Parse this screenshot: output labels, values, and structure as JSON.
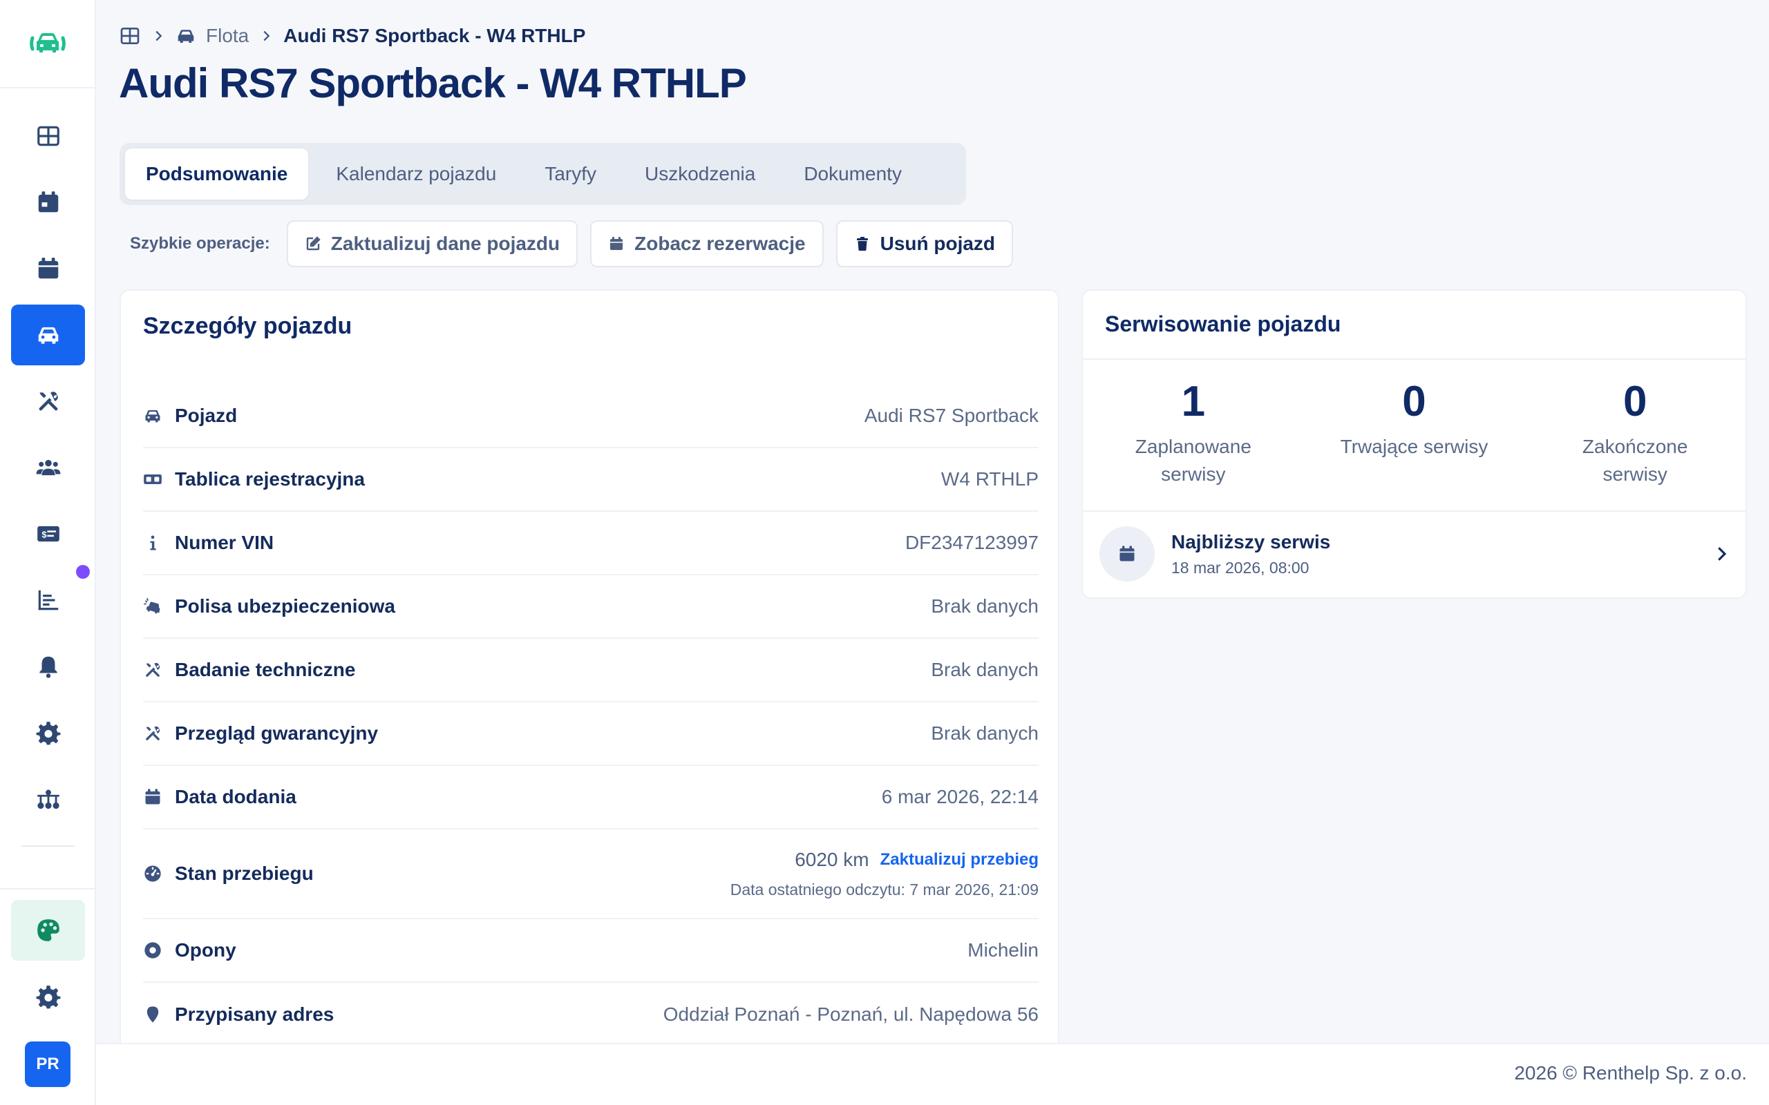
{
  "sidebar": {
    "items": [
      {
        "icon": "grid-icon"
      },
      {
        "icon": "calendar-check-icon"
      },
      {
        "icon": "calendar-icon"
      },
      {
        "icon": "car-icon",
        "active": true
      },
      {
        "icon": "tools-icon"
      },
      {
        "icon": "users-icon"
      },
      {
        "icon": "billing-icon"
      },
      {
        "icon": "chart-icon"
      },
      {
        "icon": "bell-icon"
      },
      {
        "icon": "gear-icon"
      },
      {
        "icon": "network-icon"
      },
      {
        "icon": "palette-icon"
      },
      {
        "icon": "settings-cog-icon"
      }
    ],
    "avatar_initials": "PR"
  },
  "breadcrumb": {
    "home_icon": "grid-icon",
    "fleet_label": "Flota",
    "current": "Audi RS7 Sportback - W4 RTHLP"
  },
  "page_title": "Audi RS7 Sportback - W4 RTHLP",
  "tabs": [
    {
      "label": "Podsumowanie",
      "active": true
    },
    {
      "label": "Kalendarz pojazdu"
    },
    {
      "label": "Taryfy"
    },
    {
      "label": "Uszkodzenia"
    },
    {
      "label": "Dokumenty"
    }
  ],
  "quick_actions": {
    "label": "Szybkie operacje:",
    "update_label": "Zaktualizuj dane pojazdu",
    "reservations_label": "Zobacz rezerwacje",
    "delete_label": "Usuń pojazd"
  },
  "details": {
    "title": "Szczegóły pojazdu",
    "rows": [
      {
        "label": "Pojazd",
        "value": "Audi RS7 Sportback",
        "icon": "car-icon"
      },
      {
        "label": "Tablica rejestracyjna",
        "value": "W4 RTHLP",
        "icon": "plate-icon"
      },
      {
        "label": "Numer VIN",
        "value": "DF2347123997",
        "icon": "info-icon"
      },
      {
        "label": "Polisa ubezpieczeniowa",
        "value": "Brak danych",
        "icon": "car-crash-icon"
      },
      {
        "label": "Badanie techniczne",
        "value": "Brak danych",
        "icon": "tools-icon"
      },
      {
        "label": "Przegląd gwarancyjny",
        "value": "Brak danych",
        "icon": "tools-icon"
      },
      {
        "label": "Data dodania",
        "value": "6 mar 2026, 22:14",
        "icon": "calendar-icon"
      },
      {
        "label": "Opony",
        "value": "Michelin",
        "icon": "tire-icon"
      },
      {
        "label": "Przypisany adres",
        "value": "Oddział Poznań - Poznań, ul. Napędowa 56",
        "icon": "map-pin-icon"
      }
    ],
    "odometer": {
      "label": "Stan przebiegu",
      "value": "6020 km",
      "update_link": "Zaktualizuj przebieg",
      "last_read": "Data ostatniego odczytu: 7 mar 2026, 21:09",
      "icon": "gauge-icon"
    }
  },
  "service": {
    "title": "Serwisowanie pojazdu",
    "stats": [
      {
        "value": "1",
        "label_line1": "Zaplanowane",
        "label_line2": "serwisy"
      },
      {
        "value": "0",
        "label_line1": "Trwające serwisy",
        "label_line2": ""
      },
      {
        "value": "0",
        "label_line1": "Zakończone",
        "label_line2": "serwisy"
      }
    ],
    "next": {
      "title": "Najbliższy serwis",
      "date": "18 mar 2026, 08:00"
    }
  },
  "footer": "2026 © Renthelp Sp. z o.o.",
  "colors": {
    "primary": "#1565f0",
    "navy": "#0f2a66",
    "brand_green": "#1fbf8f",
    "notification_dot": "#7c4dff"
  }
}
